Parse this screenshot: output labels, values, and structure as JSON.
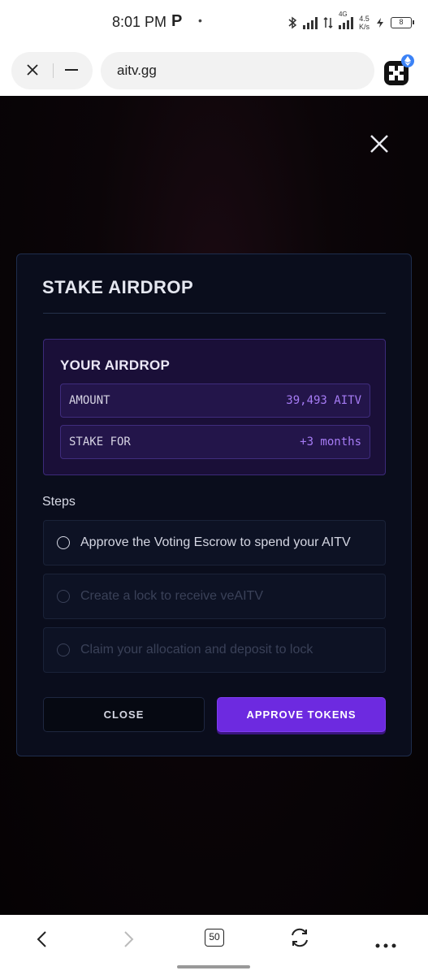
{
  "status_bar": {
    "time": "8:01 PM",
    "app_icon": "P",
    "dot": "•",
    "network": "4G",
    "speed_value": "4.5",
    "speed_unit": "K/s",
    "battery": "8"
  },
  "browser": {
    "url": "aitv.gg"
  },
  "modal": {
    "title": "STAKE AIRDROP",
    "airdrop": {
      "title": "YOUR AIRDROP",
      "amount_label": "AMOUNT",
      "amount_value": "39,493 AITV",
      "stake_label": "STAKE FOR",
      "stake_value": "+3 months"
    },
    "steps_title": "Steps",
    "steps": [
      {
        "label": "Approve the Voting Escrow to spend your AITV"
      },
      {
        "label": "Create a lock to receive veAITV"
      },
      {
        "label": "Claim your allocation and deposit to lock"
      }
    ],
    "close_label": "CLOSE",
    "approve_label": "APPROVE TOKENS"
  },
  "bottom_nav": {
    "tabs_count": "50"
  },
  "colors": {
    "accent": "#6d2ae0",
    "accent_text": "#a67cf5",
    "modal_bg": "#0a0d1c"
  }
}
